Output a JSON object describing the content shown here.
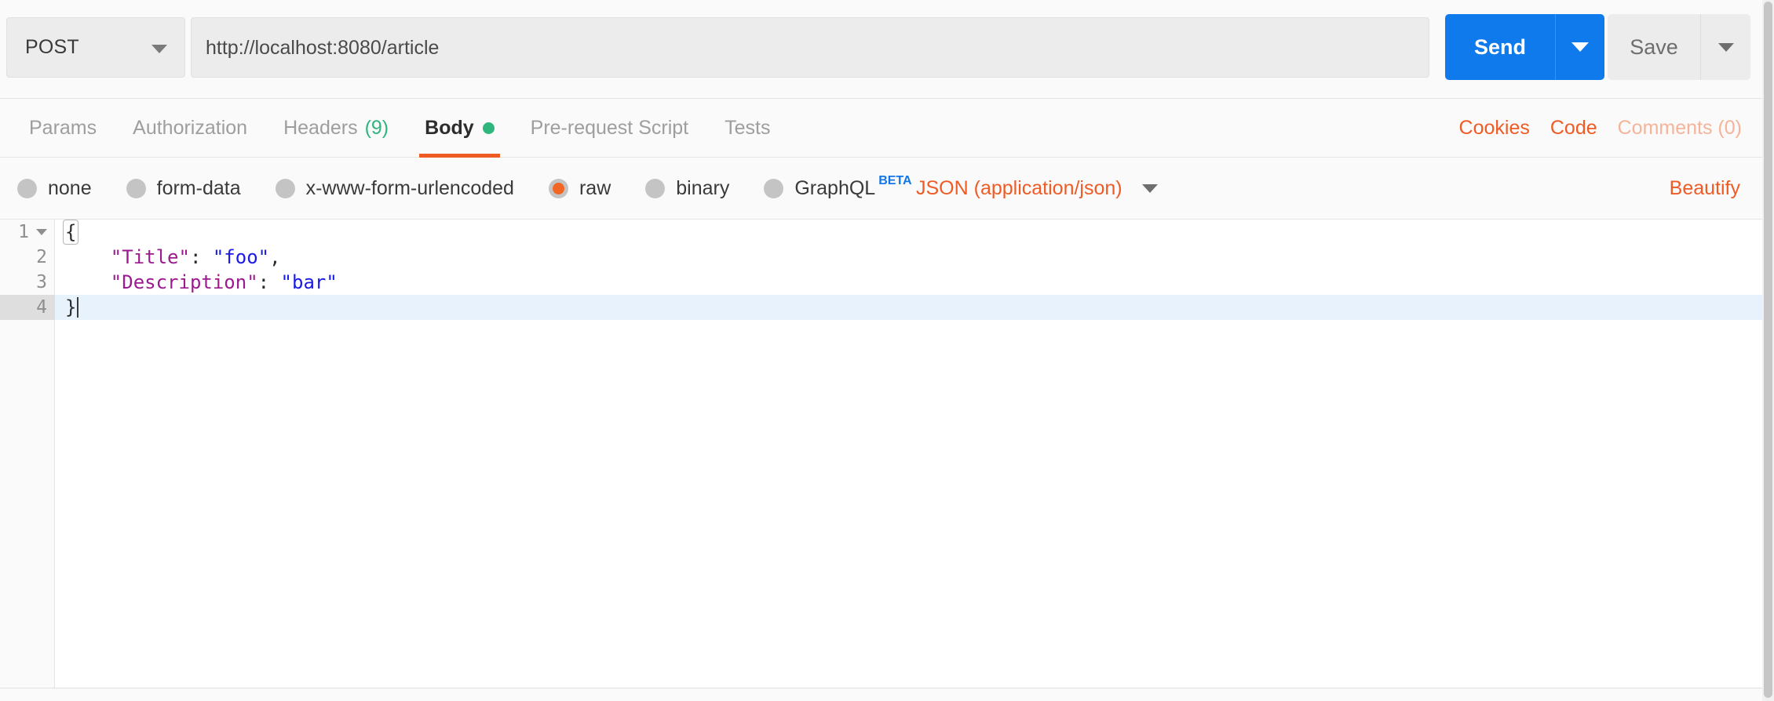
{
  "request_bar": {
    "method": "POST",
    "method_caret_icon": "chevron-down-icon",
    "url_value": "http://localhost:8080/article",
    "url_placeholder": "Enter request URL",
    "send_label": "Send",
    "send_caret_icon": "chevron-down-icon",
    "save_label": "Save",
    "save_caret_icon": "chevron-down-icon",
    "accent_blue": "#0f7aeb"
  },
  "tabs": {
    "items": [
      {
        "label": "Params",
        "count": "",
        "active": false
      },
      {
        "label": "Authorization",
        "count": "",
        "active": false
      },
      {
        "label": "Headers",
        "count": "(9)",
        "active": false
      },
      {
        "label": "Body",
        "count": "",
        "active": true,
        "dot": true
      },
      {
        "label": "Pre-request Script",
        "count": "",
        "active": false
      },
      {
        "label": "Tests",
        "count": "",
        "active": false
      }
    ],
    "active_underline_color": "#ef5b25",
    "count_color": "#2eb67d",
    "actions": [
      {
        "label": "Cookies",
        "muted": false
      },
      {
        "label": "Code",
        "muted": false
      },
      {
        "label": "Comments (0)",
        "muted": true
      }
    ]
  },
  "body_type": {
    "options": [
      {
        "label": "none",
        "selected": false
      },
      {
        "label": "form-data",
        "selected": false
      },
      {
        "label": "x-www-form-urlencoded",
        "selected": false
      },
      {
        "label": "raw",
        "selected": true
      },
      {
        "label": "binary",
        "selected": false
      },
      {
        "label": "GraphQL",
        "selected": false,
        "badge": "BETA"
      }
    ],
    "selected_color": "#f26522",
    "content_type": "JSON (application/json)",
    "content_type_caret_icon": "chevron-down-icon",
    "beautify_label": "Beautify"
  },
  "editor": {
    "lines": [
      {
        "num": "1",
        "foldable": true,
        "active": false,
        "tokens": [
          {
            "text": "{",
            "type": "brace-match"
          }
        ]
      },
      {
        "num": "2",
        "foldable": false,
        "active": false,
        "tokens": [
          {
            "text": "    ",
            "type": "punct"
          },
          {
            "text": "\"Title\"",
            "type": "key"
          },
          {
            "text": ": ",
            "type": "punct"
          },
          {
            "text": "\"foo\"",
            "type": "str"
          },
          {
            "text": ",",
            "type": "punct"
          }
        ]
      },
      {
        "num": "3",
        "foldable": false,
        "active": false,
        "tokens": [
          {
            "text": "    ",
            "type": "punct"
          },
          {
            "text": "\"Description\"",
            "type": "key"
          },
          {
            "text": ": ",
            "type": "punct"
          },
          {
            "text": "\"bar\"",
            "type": "str"
          }
        ]
      },
      {
        "num": "4",
        "foldable": false,
        "active": true,
        "cursor": true,
        "tokens": [
          {
            "text": "}",
            "type": "punct"
          }
        ]
      }
    ],
    "active_line_bg": "#e8f2fd",
    "key_color": "#9b1b8f",
    "string_color": "#1a1ae6"
  },
  "scrollbar": {
    "orientation": "vertical",
    "position": "right"
  }
}
